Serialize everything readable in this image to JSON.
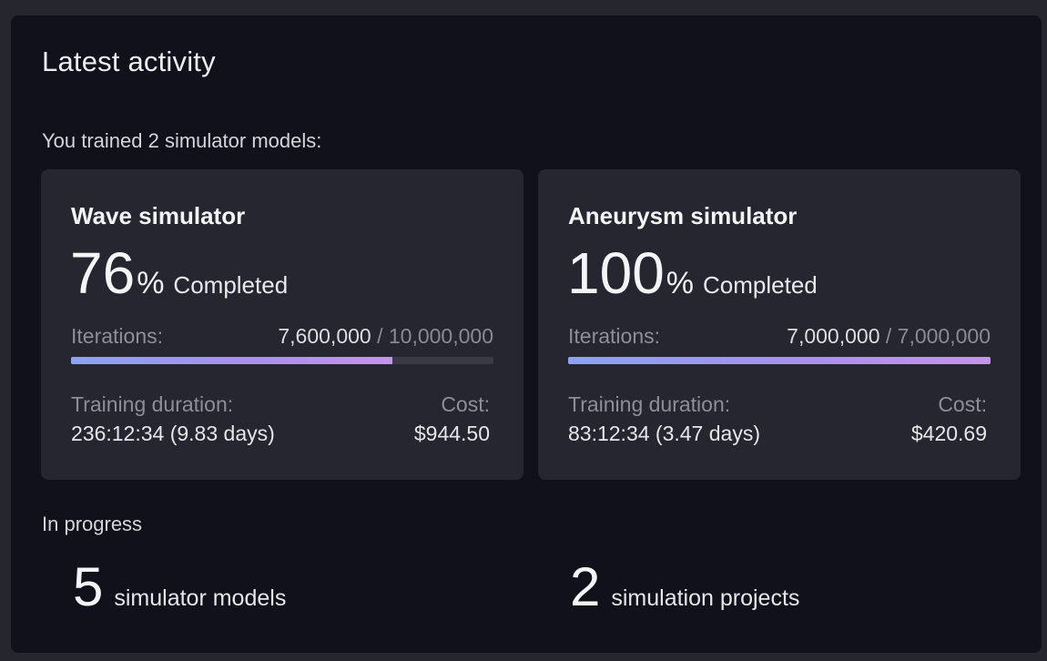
{
  "panel": {
    "title": "Latest activity",
    "intro": "You trained 2 simulator models:"
  },
  "cards": [
    {
      "title": "Wave simulator",
      "percent": "76",
      "percent_sign": "%",
      "percent_label": "Completed",
      "progress_fraction": 0.76,
      "iterations_label": "Iterations:",
      "iterations_done": "7,600,000",
      "iterations_separator": "/",
      "iterations_total": "10,000,000",
      "duration_label": "Training duration:",
      "duration_value": "236:12:34 (9.83 days)",
      "cost_label": "Cost:",
      "cost_value": "$944.50"
    },
    {
      "title": "Aneurysm simulator",
      "percent": "100",
      "percent_sign": "%",
      "percent_label": "Completed",
      "progress_fraction": 1.0,
      "iterations_label": "Iterations:",
      "iterations_done": "7,000,000",
      "iterations_separator": "/",
      "iterations_total": "7,000,000",
      "duration_label": "Training duration:",
      "duration_value": "83:12:34 (3.47 days)",
      "cost_label": "Cost:",
      "cost_value": "$420.69"
    }
  ],
  "in_progress": {
    "label": "In progress",
    "stats": [
      {
        "count": "5",
        "label": "simulator models"
      },
      {
        "count": "2",
        "label": "simulation projects"
      }
    ]
  },
  "colors": {
    "page_background": "#26262f",
    "panel_background": "#11111b",
    "card_background": "#262631",
    "progress_gradient_start": "#8aa3f4",
    "progress_gradient_end": "#c693ec",
    "track": "#3a3a46"
  }
}
